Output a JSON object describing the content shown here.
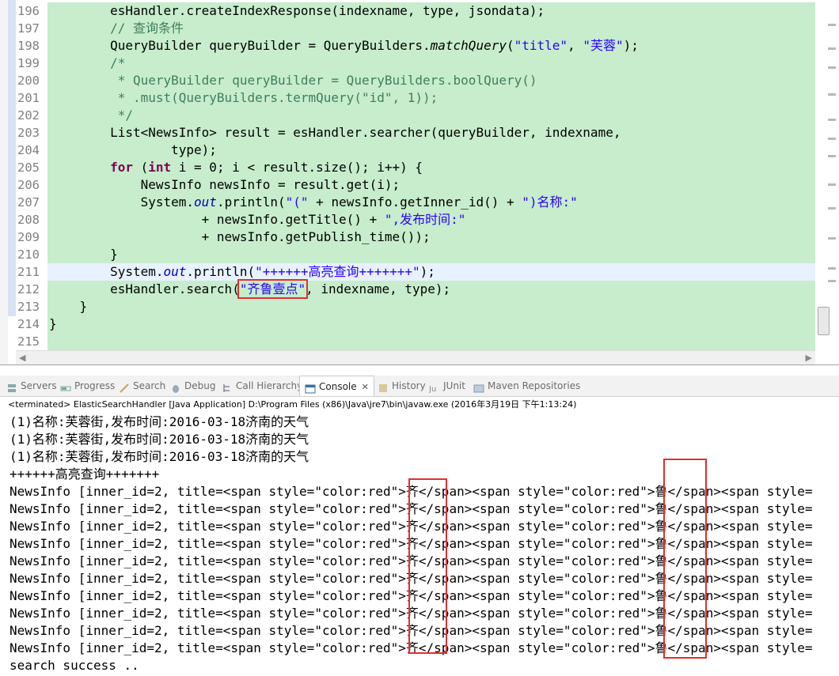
{
  "editor": {
    "line_numbers": [
      "196",
      "197",
      "198",
      "199",
      "200",
      "201",
      "202",
      "203",
      "204",
      "205",
      "206",
      "207",
      "208",
      "209",
      "210",
      "211",
      "212",
      "213",
      "214",
      "215"
    ],
    "lines": [
      [
        "        esHandler.createIndexResponse(indexname, type, jsondata);"
      ],
      [
        "        // 查询条件"
      ],
      [
        "        QueryBuilder queryBuilder = QueryBuilders.",
        "matchQuery",
        "(",
        "\"title\"",
        ", ",
        "\"芙蓉\"",
        ");"
      ],
      [
        "        /*"
      ],
      [
        "         * QueryBuilder queryBuilder = QueryBuilders.boolQuery()"
      ],
      [
        "         * .must(QueryBuilders.termQuery(\"id\", 1));"
      ],
      [
        "         */"
      ],
      [
        "        List<NewsInfo> result = esHandler.searcher(queryBuilder, indexname,"
      ],
      [
        "                type);"
      ],
      [
        "        ",
        "for",
        " (",
        "int",
        " i = 0; i < result.size(); i++) {"
      ],
      [
        "            NewsInfo newsInfo = result.get(i);"
      ],
      [
        "            System.",
        "out",
        ".println(",
        "\"(\"",
        " + newsInfo.getInner_id() + ",
        "\")名称:\""
      ],
      [
        "                    + newsInfo.getTitle() + ",
        "\",发布时间:\""
      ],
      [
        "                    + newsInfo.getPublish_time());"
      ],
      [
        "        }"
      ],
      [
        "        System.",
        "out",
        ".println(",
        "\"++++++高亮查询+++++++\"",
        ");"
      ],
      [
        "        esHandler.search(",
        "\"齐鲁壹点\"",
        ", indexname, type);"
      ],
      [
        "    }"
      ],
      [
        "}"
      ],
      [
        ""
      ]
    ]
  },
  "views": {
    "tabs": [
      {
        "label": "Servers",
        "icon": "servers-icon"
      },
      {
        "label": "Progress",
        "icon": "progress-icon"
      },
      {
        "label": "Search",
        "icon": "search-icon"
      },
      {
        "label": "Debug",
        "icon": "debug-icon"
      },
      {
        "label": "Call Hierarchy",
        "icon": "call-hierarchy-icon"
      },
      {
        "label": "Console",
        "icon": "console-icon",
        "close": "✕"
      },
      {
        "label": "History",
        "icon": "history-icon"
      },
      {
        "label": "JUnit",
        "icon": "junit-icon"
      },
      {
        "label": "Maven Repositories",
        "icon": "maven-repositories-icon"
      }
    ]
  },
  "console": {
    "status": "<terminated> ElasticSearchHandler [Java Application] D:\\Program Files (x86)\\Java\\jre7\\bin\\javaw.exe (2016年3月19日 下午1:13:24)",
    "lines": [
      "(1)名称:芙蓉街,发布时间:2016-03-18济南的天气",
      "(1)名称:芙蓉街,发布时间:2016-03-18济南的天气",
      "(1)名称:芙蓉街,发布时间:2016-03-18济南的天气",
      "++++++高亮查询+++++++",
      "NewsInfo [inner_id=2, title=<span style=\"color:red\">齐</span><span style=\"color:red\">鲁</span><span style=",
      "NewsInfo [inner_id=2, title=<span style=\"color:red\">齐</span><span style=\"color:red\">鲁</span><span style=",
      "NewsInfo [inner_id=2, title=<span style=\"color:red\">齐</span><span style=\"color:red\">鲁</span><span style=",
      "NewsInfo [inner_id=2, title=<span style=\"color:red\">齐</span><span style=\"color:red\">鲁</span><span style=",
      "NewsInfo [inner_id=2, title=<span style=\"color:red\">齐</span><span style=\"color:red\">鲁</span><span style=",
      "NewsInfo [inner_id=2, title=<span style=\"color:red\">齐</span><span style=\"color:red\">鲁</span><span style=",
      "NewsInfo [inner_id=2, title=<span style=\"color:red\">齐</span><span style=\"color:red\">鲁</span><span style=",
      "NewsInfo [inner_id=2, title=<span style=\"color:red\">齐</span><span style=\"color:red\">鲁</span><span style=",
      "NewsInfo [inner_id=2, title=<span style=\"color:red\">齐</span><span style=\"color:red\">鲁</span><span style=",
      "NewsInfo [inner_id=2, title=<span style=\"color:red\">齐</span><span style=\"color:red\">鲁</span><span style=",
      "search success .."
    ]
  }
}
